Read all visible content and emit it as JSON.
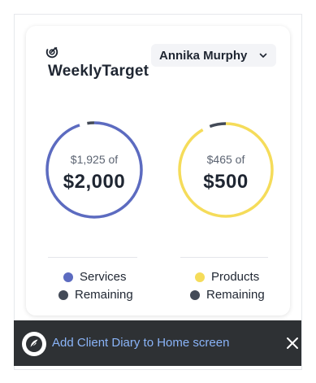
{
  "app": {
    "name": "WeeklyTarget",
    "logo_icon": "target-check-icon"
  },
  "user_select": {
    "selected": "Annika Murphy",
    "icon": "chevron-down-icon"
  },
  "targets": [
    {
      "current_text": "$1,925 of",
      "target_text": "$2,000",
      "current": 1925,
      "target": 2000,
      "progress_fraction": 0.9625,
      "color": "#5c6bc0",
      "legend_primary": "Services",
      "legend_secondary": "Remaining"
    },
    {
      "current_text": "$465 of",
      "target_text": "$500",
      "current": 465,
      "target": 500,
      "progress_fraction": 0.93,
      "color": "#f5dc5a",
      "legend_primary": "Products",
      "legend_secondary": "Remaining"
    }
  ],
  "colors": {
    "remaining": "#434a57",
    "banner_bg": "#2e3134",
    "banner_link": "#8ab4f8"
  },
  "install_banner": {
    "text": "Add Client Diary to Home screen",
    "icon": "client-diary-app-icon",
    "close_icon": "close-icon"
  }
}
